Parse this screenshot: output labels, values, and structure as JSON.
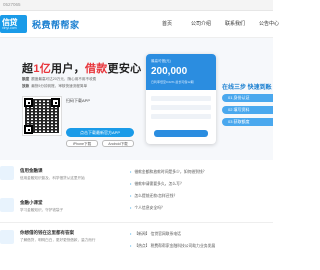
{
  "topbar": {
    "phone": "0527065"
  },
  "header": {
    "logo_text": "信贷",
    "logo_sub": "xinyi.com",
    "brand": "税费帮帮家",
    "nav": [
      "首页",
      "公司介绍",
      "联系我们",
      "公告中心"
    ]
  },
  "hero": {
    "title_prefix": "超",
    "title_highlight1": "1亿",
    "title_mid": "用户，",
    "title_highlight2": "借款",
    "title_suffix": "更安心",
    "lines": [
      {
        "tag": "额度",
        "text": "额度最高可达20万元，随心用不用不收费"
      },
      {
        "tag": "放款",
        "text": "最快5分钟到账，审核快速流程简单"
      }
    ],
    "scan_text": "扫码下载APP",
    "download_label": "点击下载最新官方APP",
    "store_ios": "iPhone下载",
    "store_android": "Android下载"
  },
  "phone": {
    "label": "最高可借(元)",
    "amount": "200,000",
    "sub": "日利率低至0.02%  最长可借12期"
  },
  "steps": {
    "title": "在线三步 快速到账",
    "items": [
      "01 身份认证",
      "02 填写资料",
      "03 获取额度"
    ]
  },
  "news": [
    {
      "title": "信用金融课",
      "desc": "信用金融知识普及，科学借贷从这里开始"
    },
    {
      "title": "金融小课堂",
      "desc": "学习金融知识，守护钱袋子"
    },
    {
      "title": "你想借的钱在这里都有答案",
      "desc": "了解借贷，明明白白，更好更快借款，量力而行"
    }
  ],
  "questions": [
    "借款金额和放款时间是多少，如何借到钱？",
    "借款申请需要多久，怎么写？",
    "怎么提前还款/怎样还钱？",
    "个人信息安全吗？",
    "【新闻】  信贷官网联系电话",
    "【热点】  税费帮帮家金融科技公司助力业务发展"
  ],
  "colors": {
    "accent": "#1a9be8",
    "highlight": "#e8353b"
  }
}
